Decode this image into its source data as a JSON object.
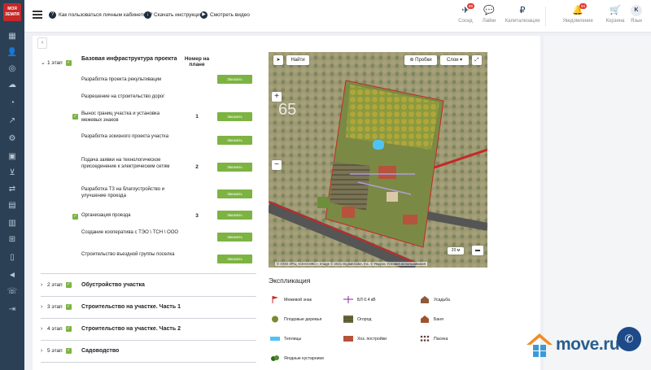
{
  "sidebar": {
    "logo_text": "МОЯ ЗЕМЛЯ",
    "icons": [
      "home-icon",
      "user-icon",
      "target-icon",
      "upload-icon",
      "pie-icon",
      "chart-icon",
      "gear-icon",
      "bag-icon",
      "cart-icon",
      "transfer-icon",
      "document-icon",
      "document-alt-icon",
      "book-icon",
      "map-icon",
      "megaphone-icon",
      "phone-icon",
      "logout-icon"
    ]
  },
  "header": {
    "links": [
      {
        "icon": "?",
        "label": "Как пользоваться личным кабинетом?"
      },
      {
        "icon": "↓",
        "label": "Скачать инструкцию"
      },
      {
        "icon": "▶",
        "label": "Смотреть видео"
      }
    ],
    "actions": [
      {
        "icon": "✈",
        "label": "Сосед",
        "badge": "98"
      },
      {
        "icon": "💬",
        "label": "Лайки",
        "badge": ""
      },
      {
        "icon": "₽",
        "label": "Капитализация",
        "badge": ""
      }
    ],
    "right_actions": [
      {
        "icon": "🔔",
        "label": "Уведомление",
        "badge": "94"
      },
      {
        "icon": "🛒",
        "label": "Корзина",
        "badge": ""
      },
      {
        "icon": "K",
        "label": "Язык",
        "badge": ""
      }
    ]
  },
  "plan": {
    "col_header": "Номер на плане",
    "stage1": {
      "label": "1 этап",
      "title": "Базовая инфраструктура проекта",
      "tasks": [
        {
          "name": "Разработка проекта рекультивации",
          "checked": false,
          "num": "",
          "button": "Заказать"
        },
        {
          "name": "Разрешение на строительство дорог",
          "checked": false,
          "num": "",
          "button": ""
        },
        {
          "name": "Вынос границ участка и установка межевых знаков",
          "checked": true,
          "num": "1",
          "button": "Заказать"
        },
        {
          "name": "Разработка эскизного проекта участка",
          "checked": false,
          "num": "",
          "button": "Заказать"
        },
        {
          "name": "Подача заявки на технологическое присоединение к электрическим сетям",
          "checked": false,
          "num": "2",
          "button": "Заказать"
        },
        {
          "name": "Разработка ТЗ на благоустройство и улучшение проезда",
          "checked": false,
          "num": "",
          "button": "Заказать"
        },
        {
          "name": "Организация проезда",
          "checked": true,
          "num": "3",
          "button": "Заказать"
        },
        {
          "name": "Создание кооператива с ТЭО \\ ТСН \\ ООО",
          "checked": false,
          "num": "",
          "button": "Заказать"
        },
        {
          "name": "Строительство въездной группы поселка",
          "checked": false,
          "num": "",
          "button": "Заказать"
        }
      ]
    },
    "stages": [
      {
        "label": "2 этап",
        "title": "Обустройство участка"
      },
      {
        "label": "3 этап",
        "title": "Строительство на участке. Часть 1"
      },
      {
        "label": "4 этап",
        "title": "Строительство на участке. Часть 2"
      },
      {
        "label": "5 этап",
        "title": "Садоводство"
      }
    ]
  },
  "map": {
    "find_button": "Найти",
    "traffic_button": "Пробки",
    "layers_button": "Слои",
    "zoom_level": "65",
    "scale": "20 м",
    "copyright": "© ООО ИТЦ «СКАНЭКС», Image © 2021 DigitalGlobe, Inc. © Яндекс Условия использования"
  },
  "legend": {
    "title": "Экспликация",
    "items": [
      {
        "label": "Межевой знак",
        "color": "#c62828"
      },
      {
        "label": "БЛ 0.4 кВ",
        "color": "#8e24aa"
      },
      {
        "label": "Усадьба",
        "color": "#8d5b3a"
      },
      {
        "label": "Плодовые деревья",
        "color": "#7a8a2e"
      },
      {
        "label": "Огород",
        "color": "#6b6b3a"
      },
      {
        "label": "Баня",
        "color": "#a0522d"
      },
      {
        "label": "Теплицы",
        "color": "#4fc3f7"
      },
      {
        "label": "Хоз. постройки",
        "color": "#b5533c"
      },
      {
        "label": "Пасека",
        "color": "#5d4037"
      },
      {
        "label": "Ягодные кустарники",
        "color": "#33691e"
      }
    ]
  },
  "brand": {
    "logo_text": "move.ru",
    "accent": "#7cb342",
    "dark": "#2b4055"
  }
}
